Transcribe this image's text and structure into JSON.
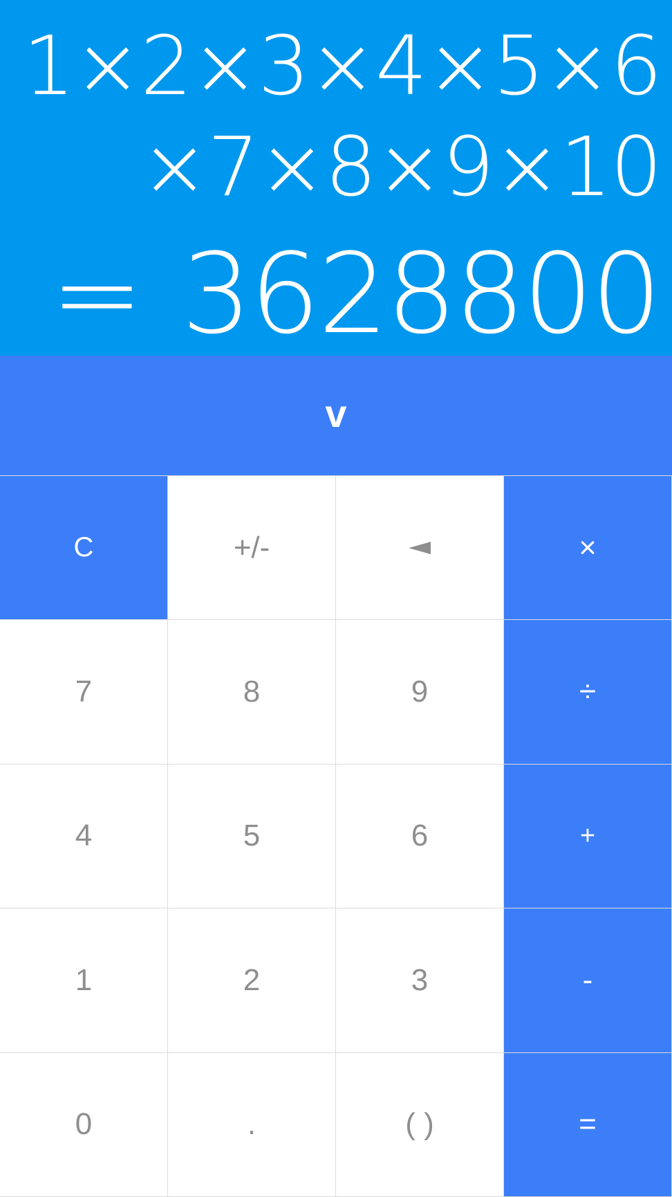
{
  "display": {
    "expression": "1×2×3×4×5×6×7×8×9×10",
    "equals": "=",
    "result": "3628800"
  },
  "collapse": {
    "label": "v"
  },
  "keys": {
    "clear": "C",
    "negate": "+/-",
    "backspace_icon": "backspace-icon",
    "multiply": "×",
    "seven": "7",
    "eight": "8",
    "nine": "9",
    "divide": "÷",
    "four": "4",
    "five": "5",
    "six": "6",
    "plus": "+",
    "one": "1",
    "two": "2",
    "three": "3",
    "minus": "-",
    "zero": "0",
    "decimal": ".",
    "parentheses": "( )",
    "equals": "="
  },
  "colors": {
    "display_bg": "#0098ee",
    "accent": "#3c7ef8",
    "key_text": "#8e8e8e",
    "divider": "#dcdcdc"
  }
}
